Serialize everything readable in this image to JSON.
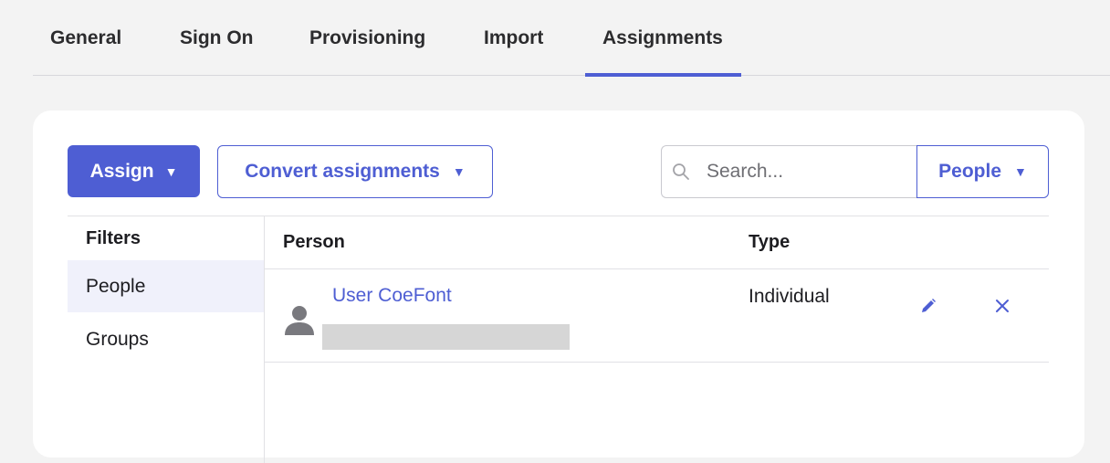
{
  "tabs": [
    {
      "label": "General"
    },
    {
      "label": "Sign On"
    },
    {
      "label": "Provisioning"
    },
    {
      "label": "Import"
    },
    {
      "label": "Assignments",
      "active": true
    }
  ],
  "toolbar": {
    "assign_label": "Assign",
    "convert_label": "Convert assignments",
    "search_placeholder": "Search...",
    "scope_label": "People"
  },
  "filters": {
    "title": "Filters",
    "items": [
      {
        "label": "People",
        "selected": true
      },
      {
        "label": "Groups",
        "selected": false
      }
    ]
  },
  "table": {
    "columns": [
      "Person",
      "Type"
    ],
    "rows": [
      {
        "name": "User CoeFont",
        "type": "Individual"
      }
    ]
  },
  "colors": {
    "accent": "#4e5ed3",
    "page_bg": "#f3f3f3",
    "selected_filter_bg": "#f0f1fb"
  },
  "icons": {
    "search": "search-icon",
    "avatar": "user-avatar-icon",
    "edit": "pencil-icon",
    "remove": "close-icon",
    "dropdown": "caret-down-icon"
  }
}
